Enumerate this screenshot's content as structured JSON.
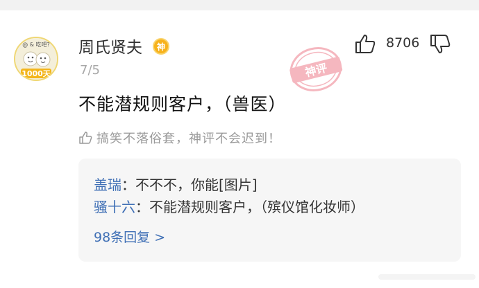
{
  "comment": {
    "user": {
      "name": "周氏贤夫",
      "badge": "神",
      "avatar_label": "1000天",
      "avatar_overlay": "@ & 吃吧?"
    },
    "date": "7/5",
    "likes": "8706",
    "stamp_text": "神评",
    "text": "不能潜规则客户，（兽医）",
    "tag": "搞笑不落俗套，神评不会迟到！"
  },
  "replies": {
    "items": [
      {
        "author": "盖瑞",
        "separator": "：",
        "text": "不不不，你能[图片]"
      },
      {
        "author": "骚十六",
        "separator": "：",
        "text": "不能潜规则客户，（殡仪馆化妆师）"
      }
    ],
    "more_label": "98条回复 >"
  },
  "colors": {
    "link": "#3f6fb5",
    "muted": "#9a9a9a",
    "stamp": "#f2a0aa",
    "badge": "#f7b21c"
  },
  "icons": {
    "like": "thumbs-up-icon",
    "dislike": "thumbs-down-icon",
    "tag": "thumbs-up-small-icon"
  }
}
